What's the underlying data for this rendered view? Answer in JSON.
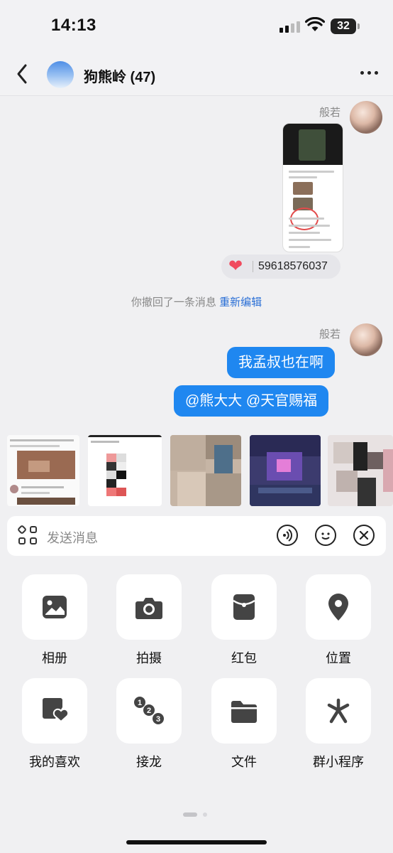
{
  "status": {
    "time": "14:13",
    "battery": "32"
  },
  "header": {
    "title": "狗熊岭 (47)"
  },
  "chat": {
    "sender_name": "般若",
    "reaction_count": "59618576037",
    "recall_text": "你撤回了一条消息",
    "recall_edit": "重新编辑",
    "messages": [
      "我孟叔也在啊",
      "@熊大大 @天官赐福"
    ]
  },
  "input": {
    "placeholder": "发送消息"
  },
  "panel": {
    "items": [
      {
        "label": "相册",
        "icon": "photo-album-icon"
      },
      {
        "label": "拍摄",
        "icon": "camera-icon"
      },
      {
        "label": "红包",
        "icon": "red-packet-icon"
      },
      {
        "label": "位置",
        "icon": "location-pin-icon"
      },
      {
        "label": "我的喜欢",
        "icon": "favorite-icon"
      },
      {
        "label": "接龙",
        "icon": "relay-icon"
      },
      {
        "label": "文件",
        "icon": "folder-icon"
      },
      {
        "label": "群小程序",
        "icon": "mini-program-icon"
      }
    ]
  },
  "colors": {
    "accent": "#1f87f0",
    "link": "#2a6fd6",
    "heart": "#f04b5e"
  }
}
